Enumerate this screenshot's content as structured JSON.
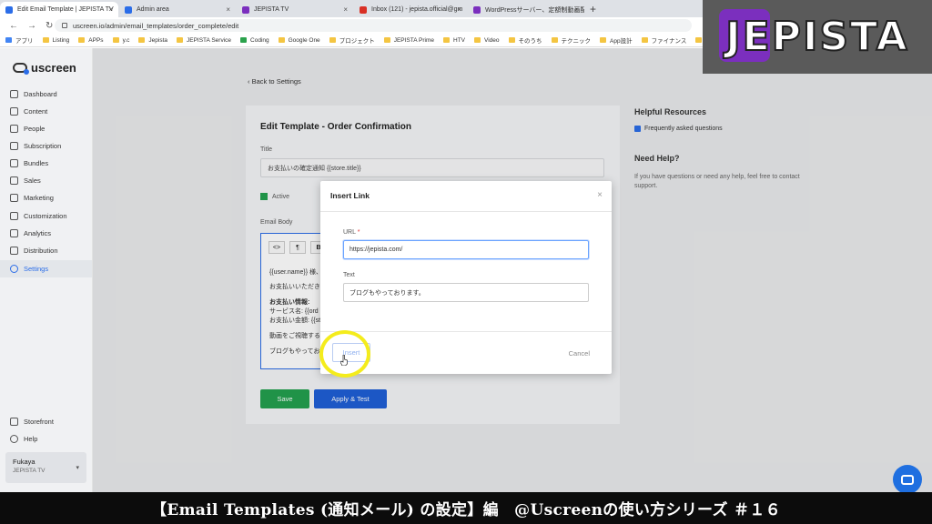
{
  "browser": {
    "tabs": [
      {
        "title": "Edit Email Template | JEPISTA TV",
        "color": "#2b6de8"
      },
      {
        "title": "Admin area",
        "color": "#2b6de8"
      },
      {
        "title": "JEPISTA TV",
        "color": "#7b2fbe"
      },
      {
        "title": "Inbox (121) - jepista.official@gm",
        "color": "#d93025"
      },
      {
        "title": "WordPressサーバー、定額制動画配",
        "color": "#7b2fbe"
      }
    ],
    "url": "uscreen.io/admin/email_templates/order_complete/edit",
    "bookmarks": [
      "アプリ",
      "Listing",
      "APPs",
      "y.c",
      "Jepista",
      "JEPISTA Service",
      "Coding",
      "Google One",
      "プロジェクト",
      "JEPISTA Prime",
      "HTV",
      "Video",
      "そのうち",
      "テクニック",
      "App設計",
      "ファイナンス",
      "セブ"
    ]
  },
  "logo": {
    "text": "JEPISTA"
  },
  "sidebar": {
    "brand": "uscreen",
    "items": [
      {
        "label": "Dashboard",
        "icon": "dashboard-icon"
      },
      {
        "label": "Content",
        "icon": "folder-icon"
      },
      {
        "label": "People",
        "icon": "people-icon"
      },
      {
        "label": "Subscription",
        "icon": "refresh-icon"
      },
      {
        "label": "Bundles",
        "icon": "box-icon"
      },
      {
        "label": "Sales",
        "icon": "dollar-icon"
      },
      {
        "label": "Marketing",
        "icon": "megaphone-icon"
      },
      {
        "label": "Customization",
        "icon": "edit-icon"
      },
      {
        "label": "Analytics",
        "icon": "chart-icon"
      },
      {
        "label": "Distribution",
        "icon": "distribution-icon"
      },
      {
        "label": "Settings",
        "icon": "gear-icon",
        "active": true
      }
    ],
    "bottom": [
      {
        "label": "Storefront",
        "icon": "storefront-icon"
      },
      {
        "label": "Help",
        "icon": "help-icon"
      }
    ],
    "user": {
      "name": "Fukaya",
      "store": "JEPISTA TV"
    }
  },
  "page": {
    "back": "Back to Settings",
    "title": "Edit Template - Order Confirmation",
    "title_label": "Title",
    "title_value": "お支払いの確定通知 {{store.title}}",
    "active_label": "Active",
    "body_label": "Email Body",
    "editor_lines": [
      "{{user.name}} 様、",
      "お支払いいただき",
      "お支払い情報:",
      "サービス名: {{ord",
      "お支払い金額: {{st",
      "動画をご視聴する",
      "ブログもやってお"
    ],
    "toolbar": [
      "<>",
      "¶",
      "B"
    ],
    "save": "Save",
    "apply": "Apply & Test"
  },
  "resources": {
    "title": "Helpful Resources",
    "faq": "Frequently asked questions",
    "help_title": "Need Help?",
    "help_text": "If you have questions or need any help, feel free to contact support."
  },
  "modal": {
    "title": "Insert Link",
    "url_label": "URL",
    "url_required": "*",
    "url_value": "https://jepista.com/",
    "text_label": "Text",
    "text_value": "ブログもやっております。",
    "insert": "Insert",
    "cancel": "Cancel"
  },
  "caption": "【Email Templates (通知メール) の設定】編　@Uscreenの使い方シリーズ ＃１６",
  "colors": {
    "accent": "#2b6de8",
    "save": "#23a04f",
    "apply": "#1f5fd6",
    "highlight": "#f4ec1c"
  }
}
